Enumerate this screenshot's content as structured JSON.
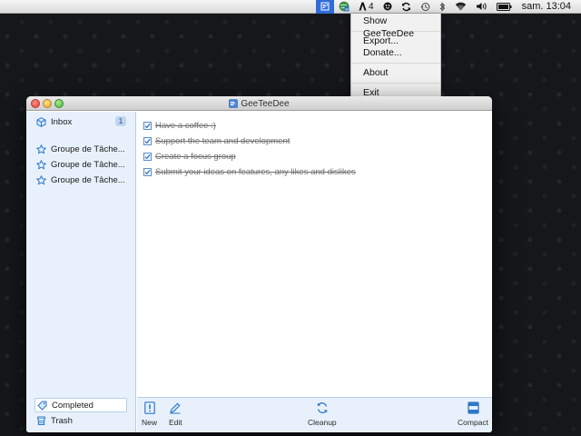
{
  "menubar": {
    "badge_count": "4",
    "clock": "sam. 13:04"
  },
  "status_menu": {
    "items": [
      {
        "label": "Show GeeTeeDee"
      },
      {
        "label": "Export..."
      },
      {
        "label": "Donate..."
      },
      {
        "label": "About"
      },
      {
        "label": "Exit"
      }
    ]
  },
  "window": {
    "title": "GeeTeeDee"
  },
  "sidebar": {
    "inbox": {
      "label": "Inbox",
      "count": "1"
    },
    "groups": [
      {
        "label": "Groupe de Tâche..."
      },
      {
        "label": "Groupe de Tâche..."
      },
      {
        "label": "Groupe de Tâche..."
      }
    ],
    "completed": {
      "label": "Completed"
    },
    "trash": {
      "label": "Trash"
    }
  },
  "tasks": [
    {
      "text": "Have a coffee :)",
      "done": true
    },
    {
      "text": "Support the team and development",
      "done": true
    },
    {
      "text": "Create a focus group",
      "done": true
    },
    {
      "text": "Submit your ideas on features, any likes and dislikes",
      "done": true
    }
  ],
  "toolbar": {
    "new_label": "New",
    "edit_label": "Edit",
    "cleanup_label": "Cleanup",
    "compact_label": "Compact"
  },
  "colors": {
    "accent": "#2f6cd6",
    "sidebar_bg": "#e8f1fb",
    "icon_blue": "#2d78c8"
  }
}
